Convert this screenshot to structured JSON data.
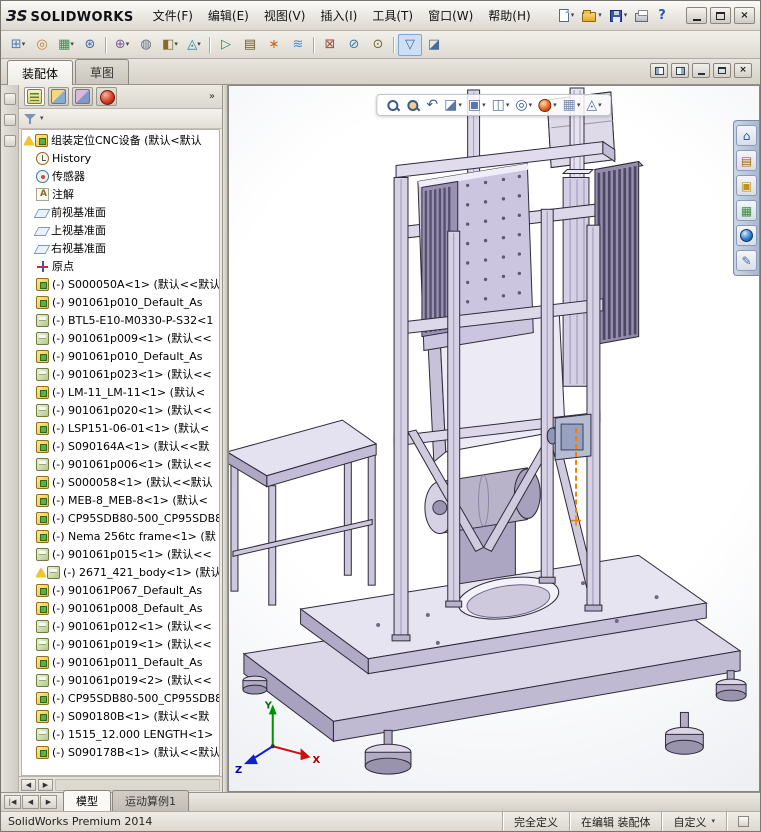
{
  "titlebar": {
    "brand_mark": "ЗS",
    "brand_name": "SOLIDWORKS",
    "menus": [
      {
        "label": "文件(F)"
      },
      {
        "label": "编辑(E)"
      },
      {
        "label": "视图(V)"
      },
      {
        "label": "插入(I)"
      },
      {
        "label": "工具(T)"
      },
      {
        "label": "窗口(W)"
      },
      {
        "label": "帮助(H)"
      }
    ]
  },
  "ui": {
    "arrow": "▾",
    "help": "?",
    "close": "×",
    "overflow": "»",
    "scroll_left": "◀",
    "scroll_right": "▶"
  },
  "toolbar": {
    "items": [
      {
        "name": "insert-components-button",
        "glyph": "⊞",
        "color": "#4a7ab0",
        "arrow": true
      },
      {
        "name": "mate-button",
        "glyph": "◎",
        "color": "#c08030"
      },
      {
        "name": "linear-component-pattern-button",
        "glyph": "▦",
        "color": "#3a8a4a",
        "arrow": true
      },
      {
        "name": "smart-fasteners-button",
        "glyph": "⊛",
        "color": "#3a6aaa"
      },
      {
        "sep": true
      },
      {
        "name": "move-component-button",
        "glyph": "⊕",
        "color": "#7a5aa0",
        "arrow": true
      },
      {
        "name": "show-hidden-components-button",
        "glyph": "◍",
        "color": "#607080"
      },
      {
        "name": "assembly-features-button",
        "glyph": "◧",
        "color": "#8a6a2a",
        "arrow": true
      },
      {
        "name": "reference-geometry-button",
        "glyph": "◬",
        "color": "#2a7a9a",
        "arrow": true
      },
      {
        "sep": true
      },
      {
        "name": "new-motion-study-button",
        "glyph": "▷",
        "color": "#2a8a5a"
      },
      {
        "name": "bill-of-materials-button",
        "glyph": "▤",
        "color": "#6a5a2a"
      },
      {
        "name": "exploded-view-button",
        "glyph": "∗",
        "color": "#c06820"
      },
      {
        "name": "explode-line-sketch-button",
        "glyph": "≋",
        "color": "#4a8ac0"
      },
      {
        "sep": true
      },
      {
        "name": "interference-detection-button",
        "glyph": "⊠",
        "color": "#9a4a3a"
      },
      {
        "name": "measure-button",
        "glyph": "⊘",
        "color": "#3a7aaa"
      },
      {
        "name": "mass-properties-button",
        "glyph": "⊙",
        "color": "#6a6a3a"
      },
      {
        "sep": true
      },
      {
        "name": "selection-filter-button",
        "glyph": "▽",
        "color": "#3a6aaa",
        "active": true
      },
      {
        "name": "section-view-toolbar-button",
        "glyph": "◪",
        "color": "#4a6a9a"
      }
    ]
  },
  "command_tabs": [
    {
      "label": "装配体",
      "name": "tab-assembly",
      "active": true
    },
    {
      "label": "草图",
      "name": "tab-sketch"
    }
  ],
  "doc_controls": [
    {
      "name": "pane-split-left-button",
      "pane1": true
    },
    {
      "name": "pane-split-right-button",
      "pane2": true
    },
    {
      "name": "minimize-document-button",
      "min": true
    },
    {
      "name": "restore-document-button",
      "max": true
    },
    {
      "name": "close-document-button",
      "close": true
    }
  ],
  "tree": {
    "items": [
      {
        "icon": "asm",
        "warn": true,
        "label": "组装定位CNC设备 (默认<默认"
      },
      {
        "icon": "history",
        "child": true,
        "label": "History"
      },
      {
        "icon": "sensor",
        "child": true,
        "label": "传感器"
      },
      {
        "icon": "ann",
        "child": true,
        "label": "注解"
      },
      {
        "icon": "plane",
        "child": true,
        "label": "前视基准面"
      },
      {
        "icon": "plane",
        "child": true,
        "label": "上视基准面"
      },
      {
        "icon": "plane",
        "child": true,
        "label": "右视基准面"
      },
      {
        "icon": "origin",
        "child": true,
        "label": "原点"
      },
      {
        "icon": "asm",
        "child": true,
        "label": "(-) S000050A<1> (默认<<默认"
      },
      {
        "icon": "asm",
        "child": true,
        "label": "(-) 901061p010_Default_As"
      },
      {
        "icon": "part",
        "child": true,
        "label": "(-) BTL5-E10-M0330-P-S32<1"
      },
      {
        "icon": "part",
        "child": true,
        "label": "(-) 901061p009<1> (默认<<"
      },
      {
        "icon": "asm",
        "child": true,
        "label": "(-) 901061p010_Default_As"
      },
      {
        "icon": "part",
        "child": true,
        "label": "(-) 901061p023<1> (默认<<"
      },
      {
        "icon": "asm",
        "child": true,
        "label": "(-) LM-11_LM-11<1> (默认<"
      },
      {
        "icon": "part",
        "child": true,
        "label": "(-) 901061p020<1> (默认<<"
      },
      {
        "icon": "asm",
        "child": true,
        "label": "(-) LSP151-06-01<1> (默认<"
      },
      {
        "icon": "asm",
        "child": true,
        "label": "(-) S090164A<1> (默认<<默"
      },
      {
        "icon": "part",
        "child": true,
        "label": "(-) 901061p006<1> (默认<<"
      },
      {
        "icon": "asm",
        "child": true,
        "label": "(-) S000058<1> (默认<<默认"
      },
      {
        "icon": "asm",
        "child": true,
        "label": "(-) MEB-8_MEB-8<1> (默认<"
      },
      {
        "icon": "asm",
        "child": true,
        "label": "(-) CP95SDB80-500_CP95SDB8"
      },
      {
        "icon": "asm",
        "child": true,
        "label": "(-) Nema 256tc frame<1> (默"
      },
      {
        "icon": "part",
        "child": true,
        "label": "(-) 901061p015<1> (默认<<"
      },
      {
        "icon": "part",
        "child": true,
        "warn": true,
        "label": "(-) 2671_421_body<1> (默认"
      },
      {
        "icon": "asm",
        "child": true,
        "label": "(-) 901061P067_Default_As"
      },
      {
        "icon": "asm",
        "child": true,
        "label": "(-) 901061p008_Default_As"
      },
      {
        "icon": "part",
        "child": true,
        "label": "(-) 901061p012<1> (默认<<"
      },
      {
        "icon": "part",
        "child": true,
        "label": "(-) 901061p019<1> (默认<<"
      },
      {
        "icon": "asm",
        "child": true,
        "label": "(-) 901061p011_Default_As"
      },
      {
        "icon": "part",
        "child": true,
        "label": "(-) 901061p019<2> (默认<<"
      },
      {
        "icon": "asm",
        "child": true,
        "label": "(-) CP95SDB80-500_CP95SDB8"
      },
      {
        "icon": "asm",
        "child": true,
        "label": "(-) S090180B<1> (默认<<默"
      },
      {
        "icon": "part",
        "child": true,
        "label": "(-) 1515_12.000 LENGTH<1>"
      },
      {
        "icon": "asm",
        "child": true,
        "label": "(-) S090178B<1> (默认<<默认"
      }
    ]
  },
  "viewport": {
    "hud": [
      {
        "name": "zoom-to-fit-button",
        "mag": true
      },
      {
        "name": "zoom-to-area-button",
        "mag2": true
      },
      {
        "name": "previous-view-button",
        "glyph": "↶",
        "color": "#3a5a8a"
      },
      {
        "name": "section-view-button",
        "glyph": "◪",
        "color": "#5878a8",
        "arrow": true
      },
      {
        "name": "view-orientation-button",
        "glyph": "▣",
        "color": "#5878a8",
        "arrow": true
      },
      {
        "name": "display-style-button",
        "glyph": "◫",
        "color": "#5878a8",
        "arrow": true
      },
      {
        "name": "hide-show-items-button",
        "glyph": "◎",
        "color": "#3a5a8a",
        "arrow": true
      },
      {
        "name": "edit-appearance-button",
        "ball": true,
        "arrow": true
      },
      {
        "name": "apply-scene-button",
        "glyph": "▦",
        "color": "#7888b0",
        "arrow": true
      },
      {
        "name": "view-settings-button",
        "glyph": "◬",
        "color": "#5878a8",
        "arrow": true
      }
    ],
    "taskpane": [
      {
        "name": "solidworks-resources-button",
        "glyph": "⌂",
        "color": "#2858a8"
      },
      {
        "name": "design-library-button",
        "glyph": "▤",
        "color": "#a06a1a"
      },
      {
        "name": "file-explorer-button",
        "glyph": "▣",
        "color": "#c09020"
      },
      {
        "name": "view-palette-button",
        "glyph": "▦",
        "color": "#3a8a3a"
      },
      {
        "name": "appearances-scenes-button",
        "ball": true
      },
      {
        "name": "custom-properties-button",
        "glyph": "✎",
        "color": "#4a6a9a"
      }
    ],
    "triad": {
      "x": "X",
      "y": "Y",
      "z": "Z"
    }
  },
  "model_tabs": {
    "nav": [
      {
        "glyph": "|◀",
        "name": "first-tab-button"
      },
      {
        "glyph": "◀",
        "name": "prev-tab-button"
      },
      {
        "glyph": "▶",
        "name": "next-tab-button"
      }
    ],
    "tabs": [
      {
        "label": "模型",
        "name": "tab-model",
        "active": true
      },
      {
        "label": "运动算例1",
        "name": "tab-motion-study-1"
      }
    ]
  },
  "statusbar": {
    "left": "SolidWorks Premium 2014",
    "defined": "完全定义",
    "editing": "在编辑 装配体",
    "custom": "自定义"
  }
}
